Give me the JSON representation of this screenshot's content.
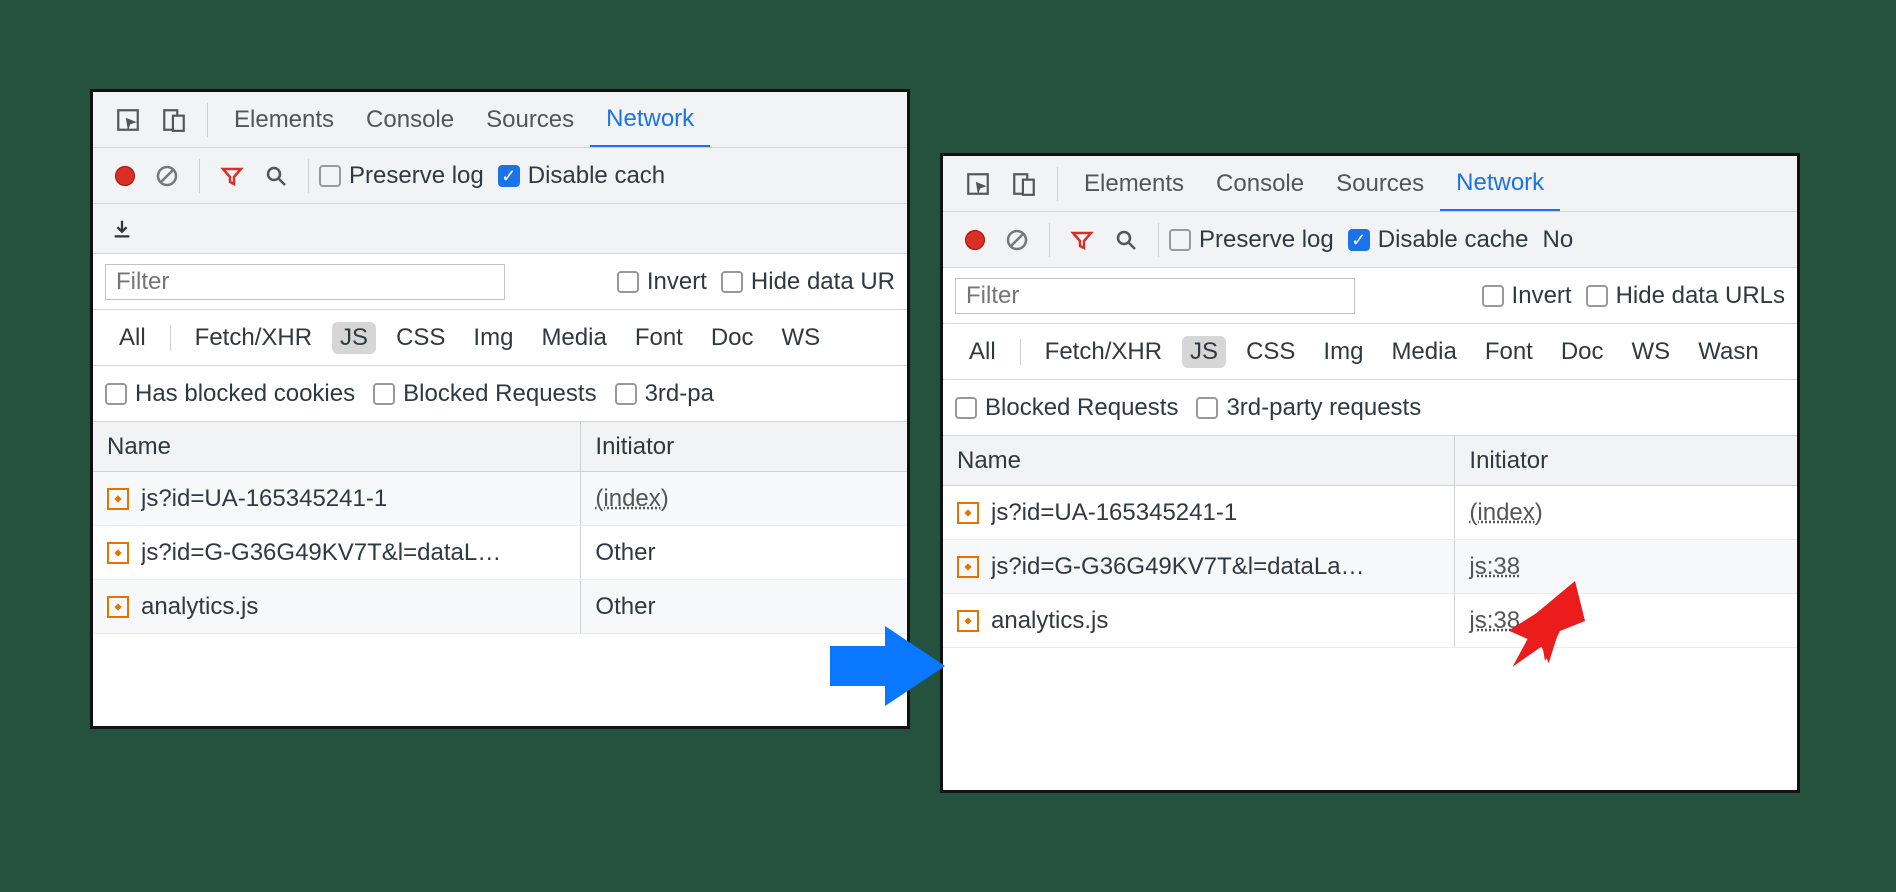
{
  "left": {
    "tabs": [
      "Elements",
      "Console",
      "Sources",
      "Network"
    ],
    "activeTab": "Network",
    "preserve": "Preserve log",
    "disable": "Disable cach",
    "filter": "Filter",
    "invert": "Invert",
    "hide": "Hide data UR",
    "types": [
      "All",
      "Fetch/XHR",
      "JS",
      "CSS",
      "Img",
      "Media",
      "Font",
      "Doc",
      "WS"
    ],
    "activeType": "JS",
    "blockedCookies": "Has blocked cookies",
    "blockedReq": "Blocked Requests",
    "thirdParty": "3rd-pa",
    "cols": {
      "name": "Name",
      "initiator": "Initiator"
    },
    "rows": [
      {
        "name": "js?id=UA-165345241-1",
        "initiator": "(index)",
        "link": true
      },
      {
        "name": "js?id=G-G36G49KV7T&l=dataL…",
        "initiator": "Other",
        "link": false
      },
      {
        "name": "analytics.js",
        "initiator": "Other",
        "link": false
      }
    ]
  },
  "right": {
    "tabs": [
      "Elements",
      "Console",
      "Sources",
      "Network"
    ],
    "activeTab": "Network",
    "preserve": "Preserve log",
    "disable": "Disable cache",
    "extra": "No",
    "filter": "Filter",
    "invert": "Invert",
    "hide": "Hide data URLs",
    "types": [
      "All",
      "Fetch/XHR",
      "JS",
      "CSS",
      "Img",
      "Media",
      "Font",
      "Doc",
      "WS",
      "Wasn"
    ],
    "activeType": "JS",
    "blockedReq": "Blocked Requests",
    "thirdParty": "3rd-party requests",
    "cols": {
      "name": "Name",
      "initiator": "Initiator"
    },
    "rows": [
      {
        "name": "js?id=UA-165345241-1",
        "initiator": "(index)",
        "link": true
      },
      {
        "name": "js?id=G-G36G49KV7T&l=dataLa…",
        "initiator": "js:38",
        "link": true
      },
      {
        "name": "analytics.js",
        "initiator": "js:38",
        "link": true
      }
    ]
  }
}
